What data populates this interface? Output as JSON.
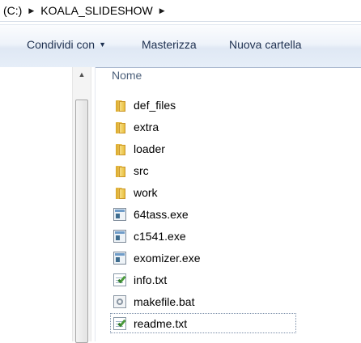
{
  "address": {
    "segments": [
      "(C:)",
      "KOALA_SLIDESHOW"
    ],
    "arrow_icon": "chevron-right-icon"
  },
  "toolbar": {
    "share_label": "Condividi con",
    "burn_label": "Masterizza",
    "new_folder_label": "Nuova cartella"
  },
  "file_list": {
    "column_header": "Nome",
    "items": [
      {
        "name": "def_files",
        "type": "folder"
      },
      {
        "name": "extra",
        "type": "folder"
      },
      {
        "name": "loader",
        "type": "folder"
      },
      {
        "name": "src",
        "type": "folder"
      },
      {
        "name": "work",
        "type": "folder"
      },
      {
        "name": "64tass.exe",
        "type": "exe"
      },
      {
        "name": "c1541.exe",
        "type": "exe"
      },
      {
        "name": "exomizer.exe",
        "type": "exe"
      },
      {
        "name": "info.txt",
        "type": "txt"
      },
      {
        "name": "makefile.bat",
        "type": "bat"
      },
      {
        "name": "readme.txt",
        "type": "txt"
      }
    ]
  }
}
